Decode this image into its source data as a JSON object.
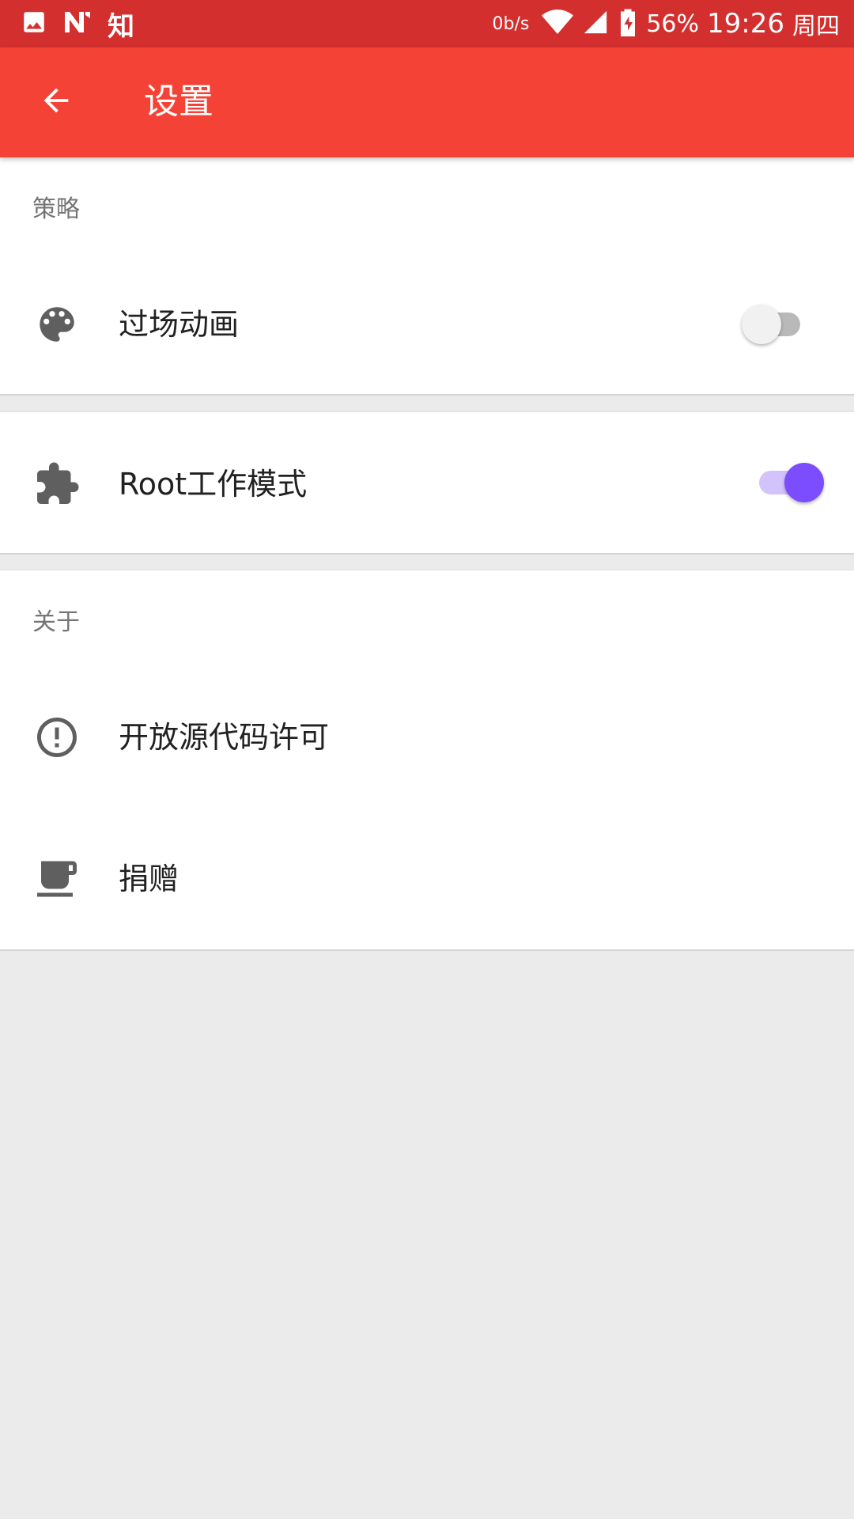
{
  "status_bar": {
    "notification_text": "知",
    "net_speed": "0b/s",
    "battery": "56%",
    "time": "19:26",
    "day": "周四",
    "icons": [
      "image-icon",
      "n-app-icon",
      "wifi-icon",
      "signal-icon",
      "battery-charging-icon"
    ]
  },
  "app_bar": {
    "title": "设置",
    "back_icon": "arrow-back-icon"
  },
  "sections": {
    "strategy": {
      "header": "策略",
      "items": [
        {
          "label": "过场动画",
          "icon": "palette-icon",
          "switch_on": false
        }
      ]
    },
    "root": {
      "items": [
        {
          "label": "Root工作模式",
          "icon": "extension-icon",
          "switch_on": true
        }
      ]
    },
    "about": {
      "header": "关于",
      "items": [
        {
          "label": "开放源代码许可",
          "icon": "error-outline-icon"
        },
        {
          "label": "捐赠",
          "icon": "coffee-icon"
        }
      ]
    }
  },
  "colors": {
    "status_bar": "#d32f2f",
    "app_bar": "#f44336",
    "accent": "#7c4dff",
    "background": "#ebebeb"
  }
}
